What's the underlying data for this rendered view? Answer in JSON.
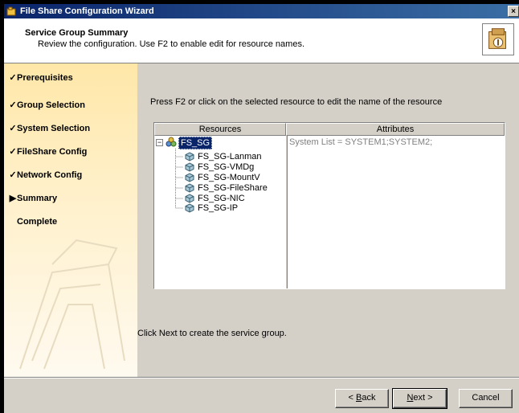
{
  "window": {
    "title": "File Share Configuration Wizard",
    "close_glyph": "×"
  },
  "header": {
    "title": "Service Group Summary",
    "subtitle": "Review the configuration. Use F2 to enable edit for resource names.",
    "icon": "wizard-icon"
  },
  "sidebar": {
    "steps": [
      {
        "label": "Prerequisites",
        "mark": "✓",
        "state": "done"
      },
      {
        "label": "Group Selection",
        "mark": "✓",
        "state": "done"
      },
      {
        "label": "System Selection",
        "mark": "✓",
        "state": "done"
      },
      {
        "label": "FileShare Config",
        "mark": "✓",
        "state": "done"
      },
      {
        "label": "Network Config",
        "mark": "✓",
        "state": "done"
      },
      {
        "label": "Summary",
        "mark": "▶",
        "state": "current"
      },
      {
        "label": "Complete",
        "mark": "",
        "state": "pending"
      }
    ]
  },
  "main": {
    "instruction": "Press F2 or click on the selected resource to edit the name of the resource",
    "grid": {
      "columns": [
        "Resources",
        "Attributes"
      ],
      "root": {
        "label": "FS_SG",
        "expander": "−"
      },
      "children": [
        "FS_SG-Lanman",
        "FS_SG-VMDg",
        "FS_SG-MountV",
        "FS_SG-FileShare",
        "FS_SG-NIC",
        "FS_SG-IP"
      ],
      "attributes": "System List = SYSTEM1;SYSTEM2;"
    },
    "footer_note": "Click Next to create the service group."
  },
  "buttons": {
    "back": {
      "mnemonic": "B",
      "rest": "ack",
      "prefix": "< "
    },
    "next": {
      "mnemonic": "N",
      "rest": "ext",
      "suffix": " >"
    },
    "cancel": "Cancel"
  }
}
